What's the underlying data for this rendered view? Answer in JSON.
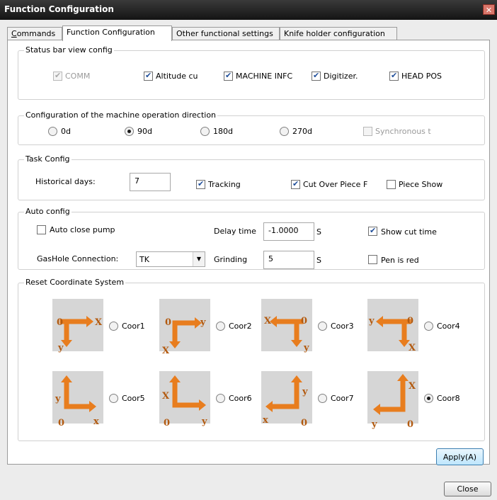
{
  "window": {
    "title": "Function Configuration",
    "close_glyph": "✕"
  },
  "tabs": [
    {
      "label_prefix": "C",
      "label_rest": "ommands",
      "active": false
    },
    {
      "label": "Function Configuration",
      "active": true
    },
    {
      "label": "Other functional settings",
      "active": false
    },
    {
      "label": "Knife holder configuration",
      "active": false
    }
  ],
  "status_bar": {
    "legend": "Status bar view config",
    "items": [
      {
        "label": "COMM",
        "checked": true,
        "disabled": true
      },
      {
        "label": "Altitude cu",
        "checked": true,
        "disabled": false
      },
      {
        "label": "MACHINE INFC",
        "checked": true,
        "disabled": false
      },
      {
        "label": "Digitizer.",
        "checked": true,
        "disabled": false
      },
      {
        "label": "HEAD POS",
        "checked": true,
        "disabled": false
      }
    ]
  },
  "direction": {
    "legend": "Configuration of the machine operation direction",
    "options": [
      "0d",
      "90d",
      "180d",
      "270d"
    ],
    "selected": "90d",
    "sync": {
      "label": "Synchronous t",
      "checked": false,
      "disabled": true
    }
  },
  "task": {
    "legend": "Task Config",
    "historical_label": "Historical days:",
    "historical_value": "7",
    "tracking_label": "Tracking",
    "tracking_checked": true,
    "cut_over_label": "Cut Over Piece F",
    "cut_over_checked": true,
    "piece_show_label": "Piece Show",
    "piece_show_checked": false
  },
  "auto": {
    "legend": "Auto config",
    "close_pump_label": "Auto close pump",
    "close_pump_checked": false,
    "delay_label": "Delay time",
    "delay_value": "-1.0000",
    "delay_unit": "S",
    "show_cut_label": "Show cut time",
    "show_cut_checked": true,
    "gashole_label": "GasHole Connection:",
    "gashole_value": "TK",
    "grinding_label": "Grinding",
    "grinding_value": "5",
    "grinding_unit": "S",
    "pen_red_label": "Pen is red",
    "pen_red_checked": false
  },
  "reset": {
    "legend": "Reset Coordinate System",
    "selected": "Coor8",
    "coords": [
      {
        "label": "Coor1",
        "labels": [
          "0",
          "X",
          "y"
        ]
      },
      {
        "label": "Coor2",
        "labels": [
          "0",
          "y",
          "X"
        ]
      },
      {
        "label": "Coor3",
        "labels": [
          "X",
          "0",
          "y"
        ]
      },
      {
        "label": "Coor4",
        "labels": [
          "y",
          "0",
          "X"
        ]
      },
      {
        "label": "Coor5",
        "labels": [
          "y",
          "0",
          "x"
        ]
      },
      {
        "label": "Coor6",
        "labels": [
          "X",
          "0",
          "y"
        ]
      },
      {
        "label": "Coor7",
        "labels": [
          "y",
          "x",
          "0"
        ]
      },
      {
        "label": "Coor8",
        "labels": [
          "X",
          "y",
          "0"
        ]
      }
    ]
  },
  "buttons": {
    "apply": "Apply(A)",
    "close": "Close"
  },
  "colors": {
    "arrow": "#e87d1e",
    "arrow_text": "#b25a10",
    "title_bar": "#1c1c1c"
  }
}
